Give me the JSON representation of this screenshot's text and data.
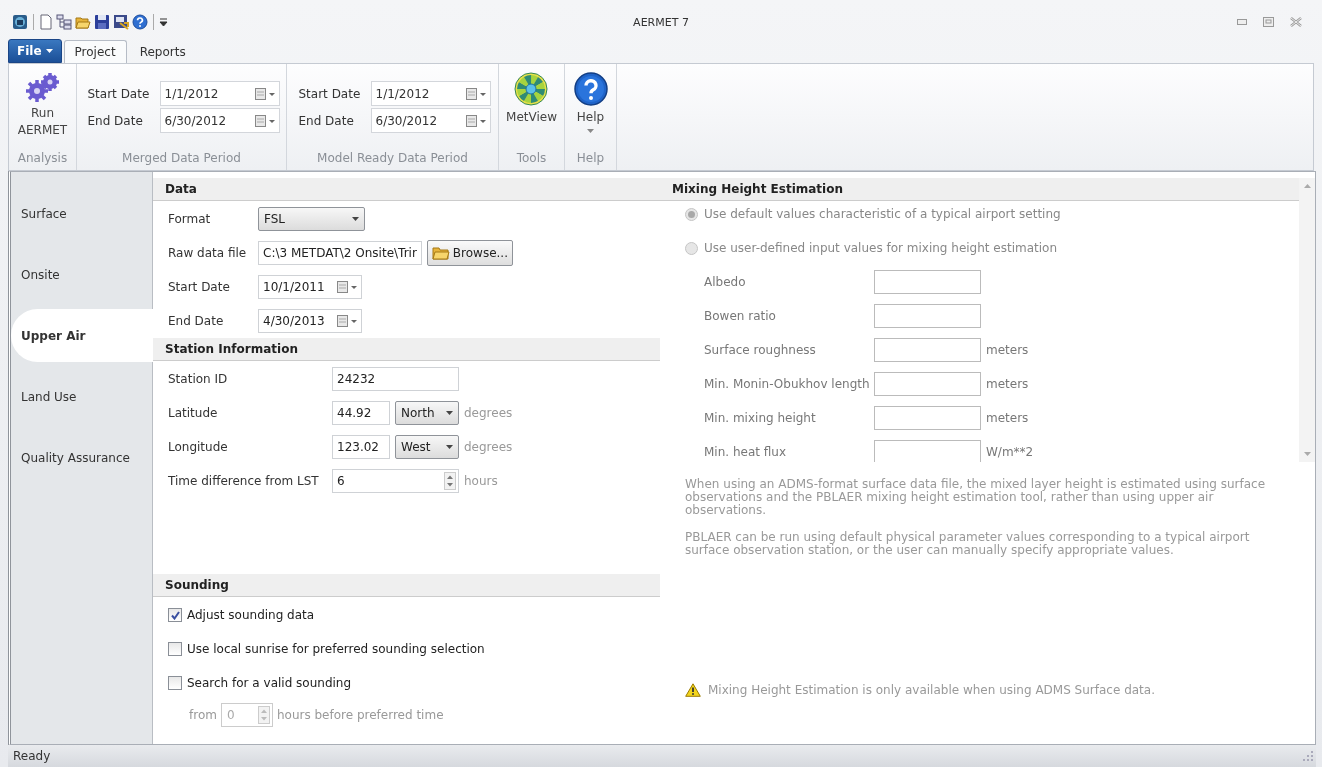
{
  "window": {
    "title": "AERMET 7"
  },
  "file_menu": {
    "label": "File"
  },
  "ribbon_tabs": [
    {
      "label": "Project",
      "selected": true
    },
    {
      "label": "Reports",
      "selected": false
    }
  ],
  "ribbon_groups": [
    {
      "label": "Analysis",
      "kind": "buttons",
      "buttons": [
        {
          "label": "Run AERMET",
          "kind": "run",
          "dropdown": false
        }
      ]
    },
    {
      "label": "Merged Data Period",
      "kind": "dates",
      "fields": [
        {
          "label": "Start Date",
          "value": "1/1/2012"
        },
        {
          "label": "End Date",
          "value": "6/30/2012"
        }
      ]
    },
    {
      "label": "Model Ready Data Period",
      "kind": "dates",
      "fields": [
        {
          "label": "Start Date",
          "value": "1/1/2012"
        },
        {
          "label": "End Date",
          "value": "6/30/2012"
        }
      ]
    },
    {
      "label": "Tools",
      "kind": "buttons",
      "buttons": [
        {
          "label": "MetView",
          "kind": "metview",
          "dropdown": false
        }
      ]
    },
    {
      "label": "Help",
      "kind": "buttons",
      "buttons": [
        {
          "label": "Help",
          "kind": "help",
          "dropdown": true
        }
      ]
    }
  ],
  "nav": {
    "items": [
      {
        "label": "Surface",
        "selected": false
      },
      {
        "label": "Onsite",
        "selected": false
      },
      {
        "label": "Upper Air",
        "selected": true
      },
      {
        "label": "Land Use",
        "selected": false
      },
      {
        "label": "Quality Assurance",
        "selected": false
      }
    ]
  },
  "data": {
    "title": "Data",
    "fields": [
      {
        "kind": "dropdown",
        "label": "Format",
        "value": "FSL"
      },
      {
        "kind": "file",
        "label": "Raw data file",
        "value": "C:\\3 METDAT\\2 Onsite\\Trir",
        "button": "Browse..."
      },
      {
        "kind": "date",
        "label": "Start Date",
        "value": "10/1/2011"
      },
      {
        "kind": "date",
        "label": "End Date",
        "value": "4/30/2013"
      }
    ]
  },
  "station": {
    "title": "Station Information",
    "fields": [
      {
        "kind": "text",
        "label": "Station ID",
        "value": "24232"
      },
      {
        "kind": "coordinate",
        "label": "Latitude",
        "value": "44.92",
        "direction": "North",
        "unit": "degrees"
      },
      {
        "kind": "coordinate",
        "label": "Longitude",
        "value": "123.02",
        "direction": "West",
        "unit": "degrees"
      },
      {
        "kind": "spin",
        "label": "Time difference from LST",
        "value": "6",
        "unit": "hours"
      }
    ]
  },
  "sounding": {
    "title": "Sounding",
    "options": [
      {
        "kind": "checkbox",
        "label": "Adjust sounding data",
        "checked": true
      },
      {
        "kind": "checkbox",
        "label": "Use local sunrise for preferred sounding selection",
        "checked": false
      },
      {
        "kind": "checkbox",
        "label": "Search for a valid sounding",
        "checked": false
      },
      {
        "kind": "spin",
        "label": "from",
        "value": "0",
        "unit": "hours before preferred time",
        "disabled": true
      }
    ]
  },
  "mixing": {
    "title": "Mixing Height Estimation",
    "options": [
      {
        "label": "Use default values characteristic of a typical airport setting",
        "selected": true,
        "disabled": true
      },
      {
        "label": "Use user-defined input values for mixing height estimation",
        "selected": false,
        "disabled": true
      }
    ],
    "inputs": [
      {
        "label": "Albedo"
      },
      {
        "label": "Bowen ratio"
      },
      {
        "label": "Surface roughness",
        "unit": "meters"
      },
      {
        "label": "Min. Monin-Obukhov length",
        "unit": "meters"
      },
      {
        "label": "Min. mixing height",
        "unit": "meters"
      },
      {
        "label": "Min. heat flux",
        "unit": "W/m**2"
      }
    ],
    "notes": [
      "When using an ADMS-format surface data file, the mixed layer height is estimated using surface observations and the PBLAER mixing height estimation tool, rather than using upper air observations.",
      "PBLAER can be run using default physical parameter values corresponding to a typical airport surface observation station, or the user can manually specify appropriate values."
    ],
    "warning": "Mixing Height Estimation is only available when using ADMS Surface data."
  },
  "status_bar": {
    "text": "Ready"
  }
}
